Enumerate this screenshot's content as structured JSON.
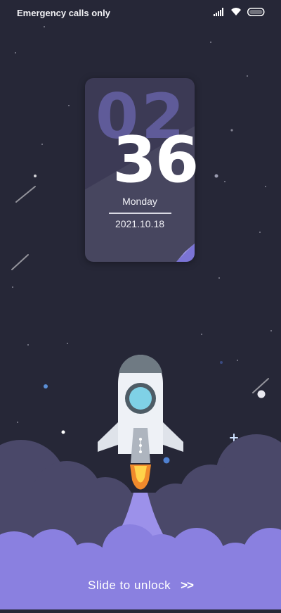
{
  "status_bar": {
    "carrier_text": "Emergency calls only",
    "icons": [
      "signal-icon",
      "wifi-icon",
      "battery-icon"
    ]
  },
  "clock": {
    "hour": "02",
    "minute": "36",
    "weekday": "Monday",
    "date": "2021.10.18"
  },
  "unlock": {
    "label": "Slide to unlock",
    "arrows": ">>"
  },
  "colors": {
    "background": "#262737",
    "cloud_dark": "#4a4869",
    "cloud_light": "#8a80e0",
    "accent": "#7b74d6"
  }
}
